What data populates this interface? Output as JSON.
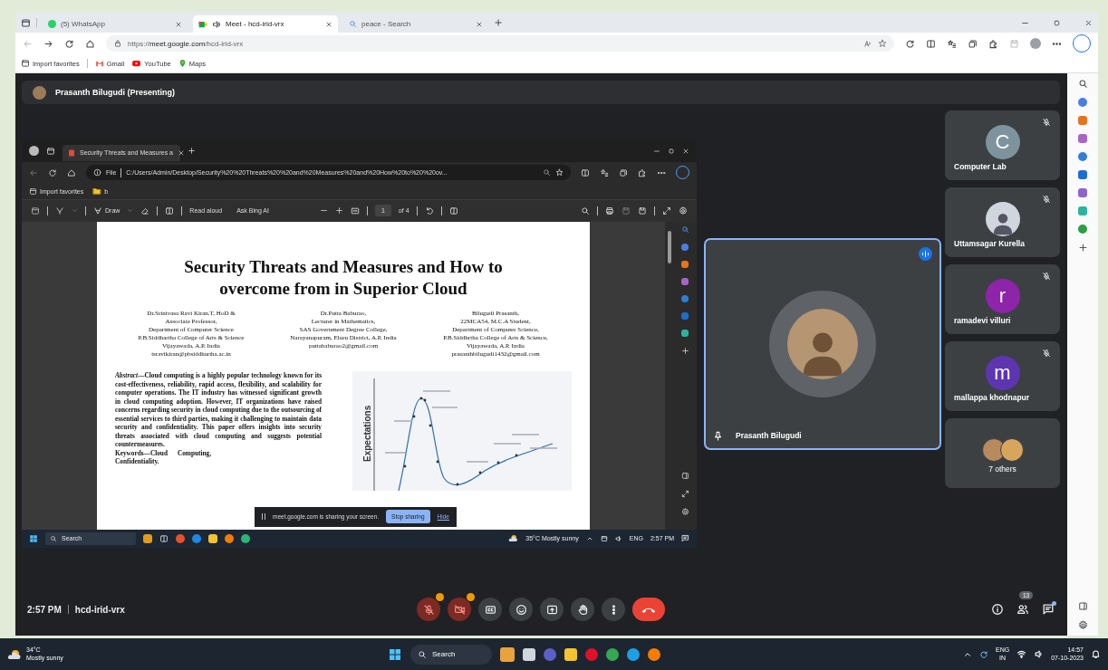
{
  "browser": {
    "tabs": [
      {
        "kind": "whatsapp",
        "title": "(5) WhatsApp",
        "selected": false,
        "playing_audio": false
      },
      {
        "kind": "meet",
        "title": "Meet - hcd-irid-vrx",
        "selected": true,
        "playing_audio": true
      },
      {
        "kind": "search",
        "title": "peace - Search",
        "selected": false,
        "playing_audio": false
      }
    ],
    "url": "https://**meet.google.com**/hcd-irid-vrx",
    "favorites": [
      {
        "kind": "import",
        "label": "Import favorites"
      },
      {
        "kind": "gmail",
        "label": "Gmail"
      },
      {
        "kind": "youtube",
        "label": "YouTube"
      },
      {
        "kind": "maps",
        "label": "Maps"
      }
    ]
  },
  "meet": {
    "presenter_banner": "Prasanth Bilugudi (Presenting)",
    "shared_screen": {
      "tab_title": "Security Threats and Measures a",
      "file_label": "File",
      "url": "C:/Users/Admin/Desktop/Security%20%20Threats%20%20and%20Measures%20and%20How%20to%20%20ov...",
      "favorites": [
        "Import favorites",
        "b"
      ],
      "toolbar": {
        "draw": "Draw",
        "read_aloud": "Read aloud",
        "ask": "Ask Bing AI",
        "page": "1",
        "page_count": "of 4"
      },
      "paper": {
        "title": "Security Threats and Measures and How to\novercome from in Superior Cloud",
        "authors": [
          "Dr.Srinivasa Ravi Kiran.T, HoD &\nAssociate Professor,\nDepartment of Computer Science\nP.B.Siddhartha College of Arts & Science\nVijayawada, A.P,  India\ntsravikiran@pbsiddhartha.ac.in",
          "Dr.Putta Baburao,\nLecturer in Mathematics,\nSAS Government Degree College,\nNarayanapuram, Eluru District, A.P, India\nputtababurao2@gmail.com",
          "Bilugudi Prasanth,\n22MCA54, M.C.A Student,\nDepartment of Computer Science,\nP.B.Siddhrtha College of Arts & Science,\nVijayawada, A.P, India\nprasanthbilugudi1432@gmail.com"
        ],
        "abstract": "*Abstract*—Cloud computing is a highly popular technology known for its cost-effectiveness, reliability, rapid access, flexibility, and scalability for computer operations. The IT industry has witnessed significant growth in cloud computing adoption. However, IT organizations have raised concerns regarding security in cloud computing due to the outsourcing of essential services to third parties, making it challenging to maintain data security and confidentiality. This paper offers insights into security threats associated with cloud computing and suggests potential countermeasures.",
        "keywords": [
          "Keywords—Cloud      Computing,",
          "Confidentiality."
        ],
        "chart_axis_label": "Expectations"
      },
      "toast": {
        "text": "meet.google.com is sharing your screen.",
        "stop": "Stop sharing",
        "hide": "Hide"
      },
      "taskbar": {
        "search": "Search",
        "weather": "35°C  Mostly sunny",
        "lang": "ENG",
        "time": "2:57 PM"
      }
    },
    "main_tile": {
      "name": "Prasanth Bilugudi",
      "speaking": true,
      "pinned": true
    },
    "participants": [
      {
        "kind": "initial",
        "initial": "C",
        "color": "#7d949e",
        "name": "Computer Lab",
        "muted": true
      },
      {
        "kind": "photo",
        "name": "Uttamsagar Kurella",
        "muted": true
      },
      {
        "kind": "initial",
        "initial": "r",
        "color": "#8e24aa",
        "name": "ramadevi villuri",
        "muted": true
      },
      {
        "kind": "initial",
        "initial": "m",
        "color": "#5e35b1",
        "name": "mallappa khodnapur",
        "muted": true
      },
      {
        "kind": "group",
        "name": "7 others",
        "muted": false
      }
    ],
    "bottom_bar": {
      "time": "2:57 PM",
      "code": "hcd-irid-vrx",
      "mic_on": false,
      "camera_on": false,
      "people_count": "13",
      "chat_unread": true
    }
  },
  "taskbar": {
    "temperature": "34°C",
    "weather": "Mostly sunny",
    "search": "Search",
    "lang": "ENG",
    "region": "IN",
    "time": "14:57",
    "date": "07-10-2023"
  }
}
